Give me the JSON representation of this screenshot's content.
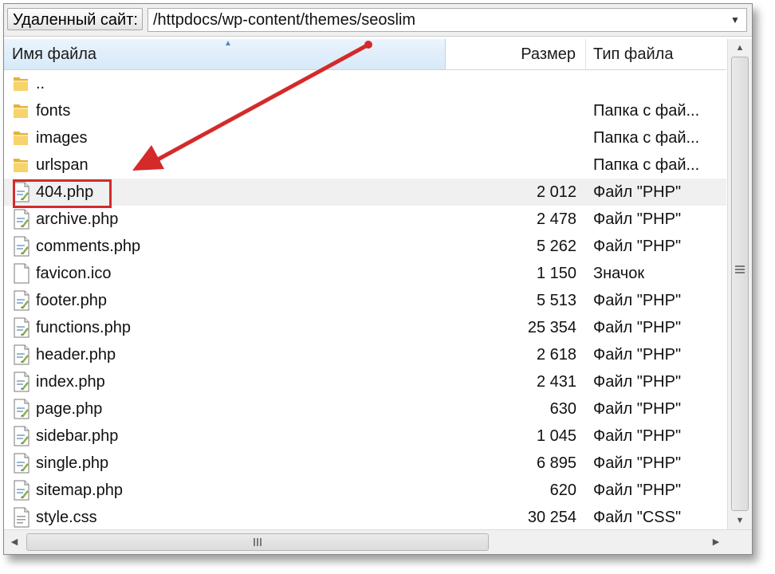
{
  "path_bar": {
    "label": "Удаленный сайт:",
    "path": "/httpdocs/wp-content/themes/seoslim"
  },
  "columns": {
    "name": "Имя файла",
    "size": "Размер",
    "type": "Тип файла"
  },
  "files": [
    {
      "name": "..",
      "size": "",
      "type": "",
      "icon": "folder-icon"
    },
    {
      "name": "fonts",
      "size": "",
      "type": "Папка с фай...",
      "icon": "folder-icon"
    },
    {
      "name": "images",
      "size": "",
      "type": "Папка с фай...",
      "icon": "folder-icon"
    },
    {
      "name": "urlspan",
      "size": "",
      "type": "Папка с фай...",
      "icon": "folder-icon"
    },
    {
      "name": "404.php",
      "size": "2 012",
      "type": "Файл \"PHP\"",
      "icon": "php-file-icon"
    },
    {
      "name": "archive.php",
      "size": "2 478",
      "type": "Файл \"PHP\"",
      "icon": "php-file-icon"
    },
    {
      "name": "comments.php",
      "size": "5 262",
      "type": "Файл \"PHP\"",
      "icon": "php-file-icon"
    },
    {
      "name": "favicon.ico",
      "size": "1 150",
      "type": "Значок",
      "icon": "blank-file-icon"
    },
    {
      "name": "footer.php",
      "size": "5 513",
      "type": "Файл \"PHP\"",
      "icon": "php-file-icon"
    },
    {
      "name": "functions.php",
      "size": "25 354",
      "type": "Файл \"PHP\"",
      "icon": "php-file-icon"
    },
    {
      "name": "header.php",
      "size": "2 618",
      "type": "Файл \"PHP\"",
      "icon": "php-file-icon"
    },
    {
      "name": "index.php",
      "size": "2 431",
      "type": "Файл \"PHP\"",
      "icon": "php-file-icon"
    },
    {
      "name": "page.php",
      "size": "630",
      "type": "Файл \"PHP\"",
      "icon": "php-file-icon"
    },
    {
      "name": "sidebar.php",
      "size": "1 045",
      "type": "Файл \"PHP\"",
      "icon": "php-file-icon"
    },
    {
      "name": "single.php",
      "size": "6 895",
      "type": "Файл \"PHP\"",
      "icon": "php-file-icon"
    },
    {
      "name": "sitemap.php",
      "size": "620",
      "type": "Файл \"PHP\"",
      "icon": "php-file-icon"
    },
    {
      "name": "style.css",
      "size": "30 254",
      "type": "Файл \"CSS\"",
      "icon": "css-file-icon"
    }
  ],
  "selected_file": "404.php",
  "colors": {
    "annotation_red": "#d42a2a",
    "header_blue": "#d7e9f8",
    "folder_yellow": "#f2c64a"
  }
}
